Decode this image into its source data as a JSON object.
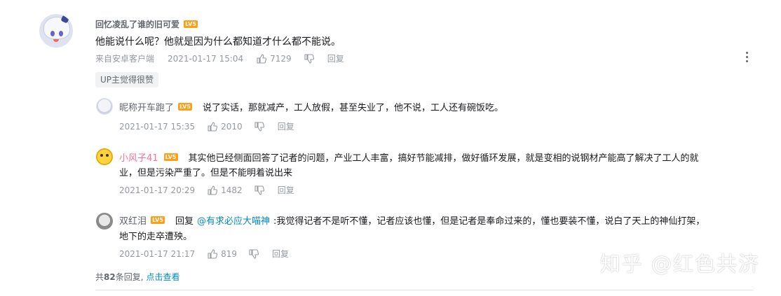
{
  "root_comment": {
    "username": "回忆凌乱了谁的旧可爱",
    "level": "LV5",
    "content": "他能说什么呢？他就是因为什么都知道才什么都不能说。",
    "source": "来自安卓客户端",
    "time": "2021-01-17 15:04",
    "likes": "7129",
    "reply_label": "回复",
    "tag": "UP主觉得很赞"
  },
  "replies": [
    {
      "username": "昵称开车跑了",
      "level": "LV5",
      "content": "说了实话，那就减产，工人放假，甚至失业了，他不说，工人还有碗饭吃。",
      "time": "2021-01-17 15:35",
      "likes": "2010",
      "reply_label": "回复"
    },
    {
      "username": "小风子41",
      "level": "LV5",
      "content_line1": "其实他已经侧面回答了记者的问题，产业工人丰富，搞好节能减排，做好循环发展，就是变相的说钢材产能高了解决了工人的就",
      "content_line2": "业，但是污染严重了。但是不能明着说出来",
      "time": "2021-01-17 20:29",
      "likes": "1482",
      "reply_label": "回复"
    },
    {
      "username": "双红泪",
      "level": "LV5",
      "reply_prefix": "回复",
      "mention": "@有求必应大喵神",
      "content_line1": ":我觉得记者不是听不懂，记者应该也懂，但是记者是奉命过来的，懂也要装不懂，说白了天上的神仙打架，",
      "content_line2": "地下的走卒遭殃。",
      "time": "2021-01-17 21:17",
      "likes": "819",
      "reply_label": "回复"
    }
  ],
  "footer": {
    "prefix": "共",
    "count": "82",
    "suffix": "条回复,",
    "view_more": "点击查看"
  },
  "watermark": "知乎 @红色共济",
  "colors": {
    "level_badge": "#ff9e17",
    "link": "#008ac5",
    "meta_gray": "#9499a0"
  }
}
